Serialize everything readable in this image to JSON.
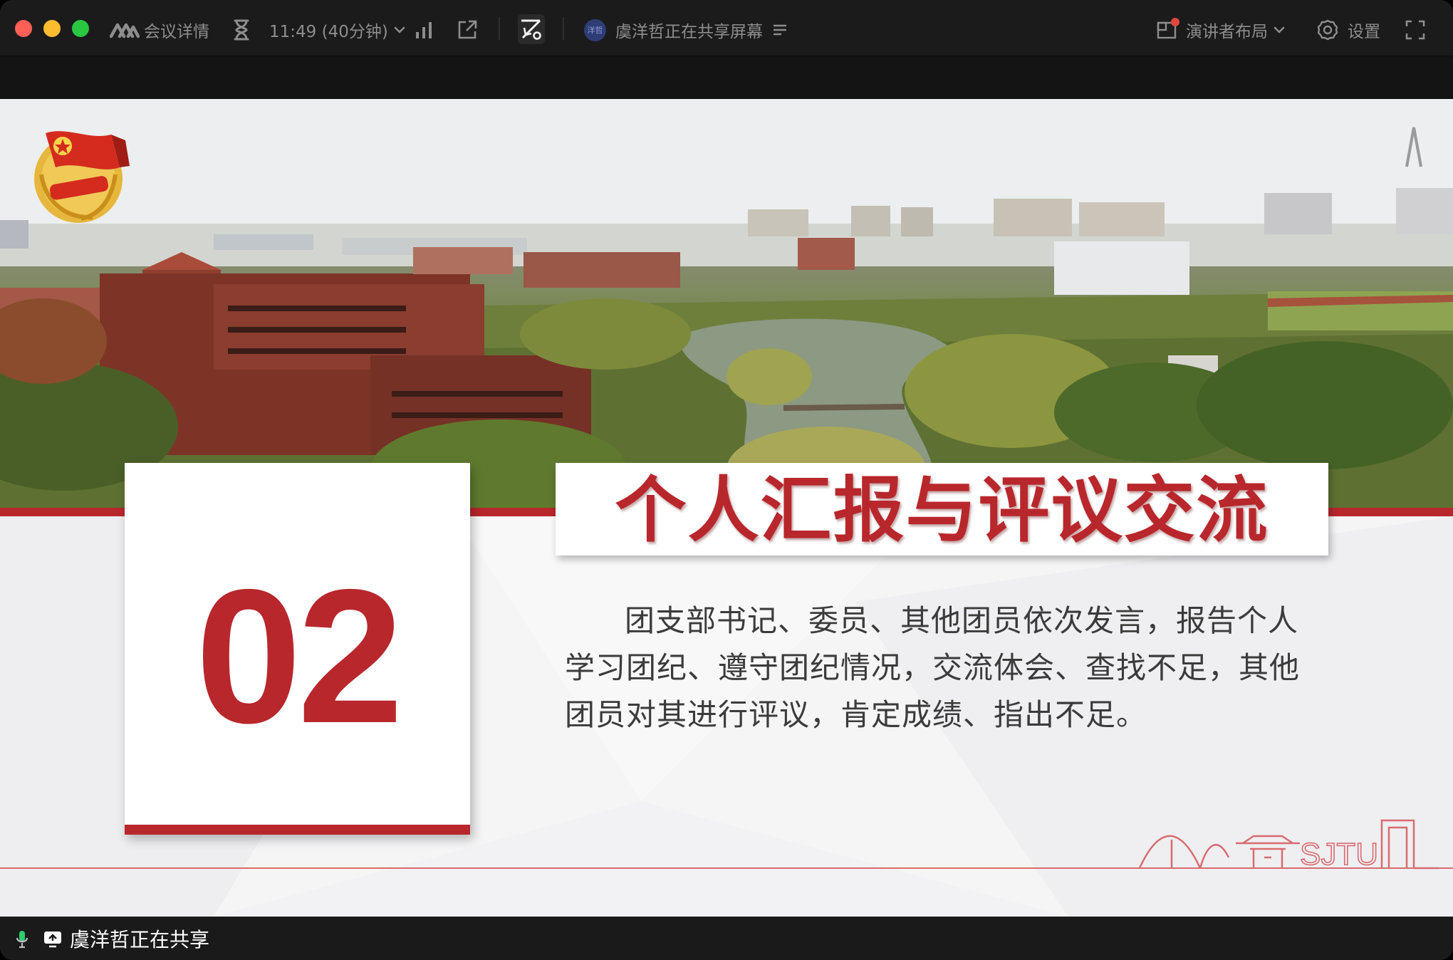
{
  "app": {
    "meeting_details": "会议详情",
    "timer": "11:49 (40分钟)",
    "sharing_status": "虞洋哲正在共享屏幕",
    "avatar_initials": "洋哲",
    "layout_label": "演讲者布局",
    "settings_label": "设置"
  },
  "slide": {
    "number": "02",
    "title": "个人汇报与评议交流",
    "body": "团支部书记、委员、其他团员依次发言，报告个人学习团纪、遵守团纪情况，交流体会、查找不足，其他团员对其进行评议，肯定成绩、指出不足。"
  },
  "footer": {
    "sharer_label": "虞洋哲正在共享"
  },
  "colors": {
    "accent_red": "#b8272c",
    "titlebar": "#1b1b1b",
    "notification_dot": "#e0463c"
  }
}
